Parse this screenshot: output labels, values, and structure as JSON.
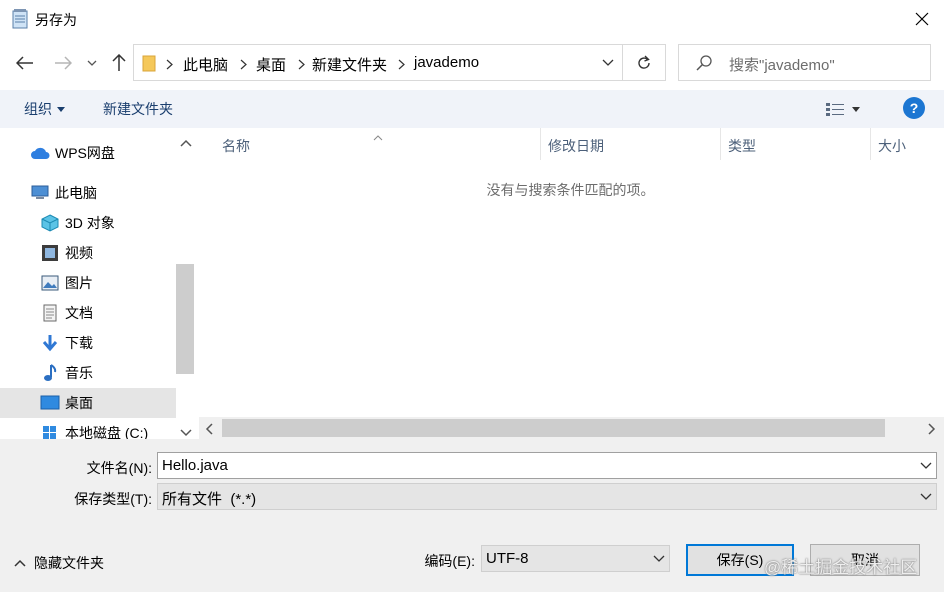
{
  "window": {
    "title": "另存为"
  },
  "address": {
    "breadcrumbs": [
      "此电脑",
      "桌面",
      "新建文件夹",
      "javademo"
    ],
    "search_placeholder": "搜索\"javademo\""
  },
  "toolbar": {
    "organize": "组织",
    "new_folder": "新建文件夹",
    "help": "?"
  },
  "nav": {
    "items": [
      {
        "label": "WPS网盘",
        "icon": "cloud-icon"
      },
      {
        "label": "此电脑",
        "icon": "computer-icon"
      },
      {
        "label": "3D 对象",
        "icon": "cube-icon"
      },
      {
        "label": "视频",
        "icon": "video-icon"
      },
      {
        "label": "图片",
        "icon": "picture-icon"
      },
      {
        "label": "文档",
        "icon": "document-icon"
      },
      {
        "label": "下载",
        "icon": "download-icon"
      },
      {
        "label": "音乐",
        "icon": "music-icon"
      },
      {
        "label": "桌面",
        "icon": "desktop-icon",
        "selected": true
      },
      {
        "label": "本地磁盘 (C:)",
        "icon": "drive-icon"
      }
    ]
  },
  "files": {
    "columns": [
      "名称",
      "修改日期",
      "类型",
      "大小"
    ],
    "empty_message": "没有与搜索条件匹配的项。"
  },
  "form": {
    "filename_label": "文件名(N):",
    "filename_value": "Hello.java",
    "filetype_label": "保存类型(T):",
    "filetype_value": "所有文件  (*.*)",
    "encoding_label": "编码(E):",
    "encoding_value": "UTF-8",
    "hide_folders": "隐藏文件夹",
    "save": "保存(S)",
    "cancel": "取消"
  },
  "watermark": "@稀土掘金技术社区",
  "colors": {
    "accent": "#0078d7",
    "link": "#1a3e6e",
    "help": "#1c76d2"
  }
}
